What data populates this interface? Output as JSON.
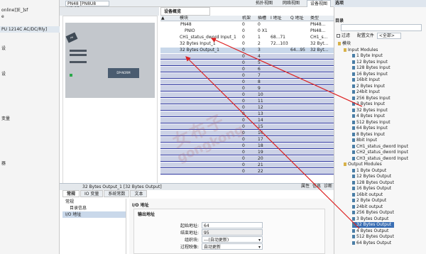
{
  "left_tree": {
    "items": [
      "online]]E_]sf",
      "e",
      "",
      "PU 1214C AC/DC/Rly]",
      "",
      "",
      "设",
      "",
      "",
      "",
      "设",
      "",
      "",
      "",
      "",
      "",
      "",
      "变量",
      "",
      "",
      "",
      "",
      "",
      "",
      "器"
    ]
  },
  "topbar": {
    "views": [
      "拓扑视图",
      "网络视图",
      "设备视图"
    ],
    "device_select": "PN48 [PN8U8 V2.1]"
  },
  "overview": {
    "tab_label": "设备概览",
    "headers": [
      "模块",
      "",
      "机架",
      "插槽",
      "I 地址",
      "Q 地址",
      "类型"
    ],
    "rows": [
      [
        "PN48",
        "0",
        "0",
        "",
        "",
        "PN48..."
      ],
      [
        "PNIO",
        "0",
        "0 X1",
        "",
        "",
        "PN48..."
      ],
      [
        "CH1_status_dword Input_1",
        "0",
        "1",
        "68...71",
        "",
        "CH1_s..."
      ],
      [
        "32 Bytes Input_1",
        "0",
        "2",
        "72...103",
        "",
        "32 Byt..."
      ],
      [
        "32 Bytes Output_1",
        "0",
        "3",
        "",
        "64...95",
        "32 Byt..."
      ],
      [
        "",
        "0",
        "4",
        "",
        "",
        ""
      ],
      [
        "",
        "0",
        "5",
        "",
        "",
        ""
      ],
      [
        "",
        "0",
        "6",
        "",
        "",
        ""
      ],
      [
        "",
        "0",
        "7",
        "",
        "",
        ""
      ],
      [
        "",
        "0",
        "8",
        "",
        "",
        ""
      ],
      [
        "",
        "0",
        "9",
        "",
        "",
        ""
      ],
      [
        "",
        "0",
        "10",
        "",
        "",
        ""
      ],
      [
        "",
        "0",
        "11",
        "",
        "",
        ""
      ],
      [
        "",
        "0",
        "12",
        "",
        "",
        ""
      ],
      [
        "",
        "0",
        "13",
        "",
        "",
        ""
      ],
      [
        "",
        "0",
        "14",
        "",
        "",
        ""
      ],
      [
        "",
        "0",
        "15",
        "",
        "",
        ""
      ],
      [
        "",
        "0",
        "16",
        "",
        "",
        ""
      ],
      [
        "",
        "0",
        "17",
        "",
        "",
        ""
      ],
      [
        "",
        "0",
        "18",
        "",
        "",
        ""
      ],
      [
        "",
        "0",
        "19",
        "",
        "",
        ""
      ],
      [
        "",
        "0",
        "20",
        "",
        "",
        ""
      ],
      [
        "",
        "0",
        "21",
        "",
        "",
        ""
      ],
      [
        "",
        "0",
        "22",
        "",
        "",
        ""
      ]
    ]
  },
  "rack": {
    "label": "DP-NORM"
  },
  "props": {
    "header_title": "32 Bytes Output_1 [32 Bytes Output]",
    "right_tabs": [
      "属性",
      "信息",
      "诊断"
    ],
    "tabs": [
      "常规",
      "IO 变量",
      "系统常数",
      "文本"
    ],
    "nav": [
      "常规",
      "目录信息",
      "I/O 地址"
    ],
    "section_title": "I/O 地址",
    "box_title": "输出地址",
    "fields": [
      {
        "label": "起始地址:",
        "value": "64"
      },
      {
        "label": "结束地址:",
        "value": "95"
      },
      {
        "label": "组织块:",
        "value": "---(自动更新)"
      },
      {
        "label": "过程映像:",
        "value": "自动更新"
      }
    ]
  },
  "catalog": {
    "title": "选项",
    "subtitle": "目录",
    "filter_label": "过滤",
    "profile_label": "配置文件",
    "profile_value": "<全部>",
    "items": [
      "模块",
      "Input Modules",
      "1 Byte Input",
      "12 Bytes Input",
      "128 Bytes Input",
      "16 Bytes Input",
      "16bit Input",
      "2 Bytes Input",
      "24bit Input",
      "256 Bytes Input",
      "3 Bytes Input",
      "32 Bytes Input",
      "4 Bytes Input",
      "512 Bytes Input",
      "64 Bytes Input",
      "8 Bytes Input",
      "8bit Input",
      "CH1_status_dword Input",
      "CH2_status_dword Input",
      "CH3_status_dword Input",
      "Output Modules",
      "1 Byte Output",
      "12 Bytes Output",
      "128 Bytes Output",
      "16 Bytes Output",
      "16bit output",
      "2 Byte Output",
      "24bit output",
      "256 Bytes Output",
      "3 Bytes Output",
      "32 Bytes Output",
      "4 Bytes Output",
      "512 Bytes Output",
      "64 Bytes Output"
    ]
  },
  "watermark": {
    "line1": "女布子",
    "line2": "gongkong"
  }
}
